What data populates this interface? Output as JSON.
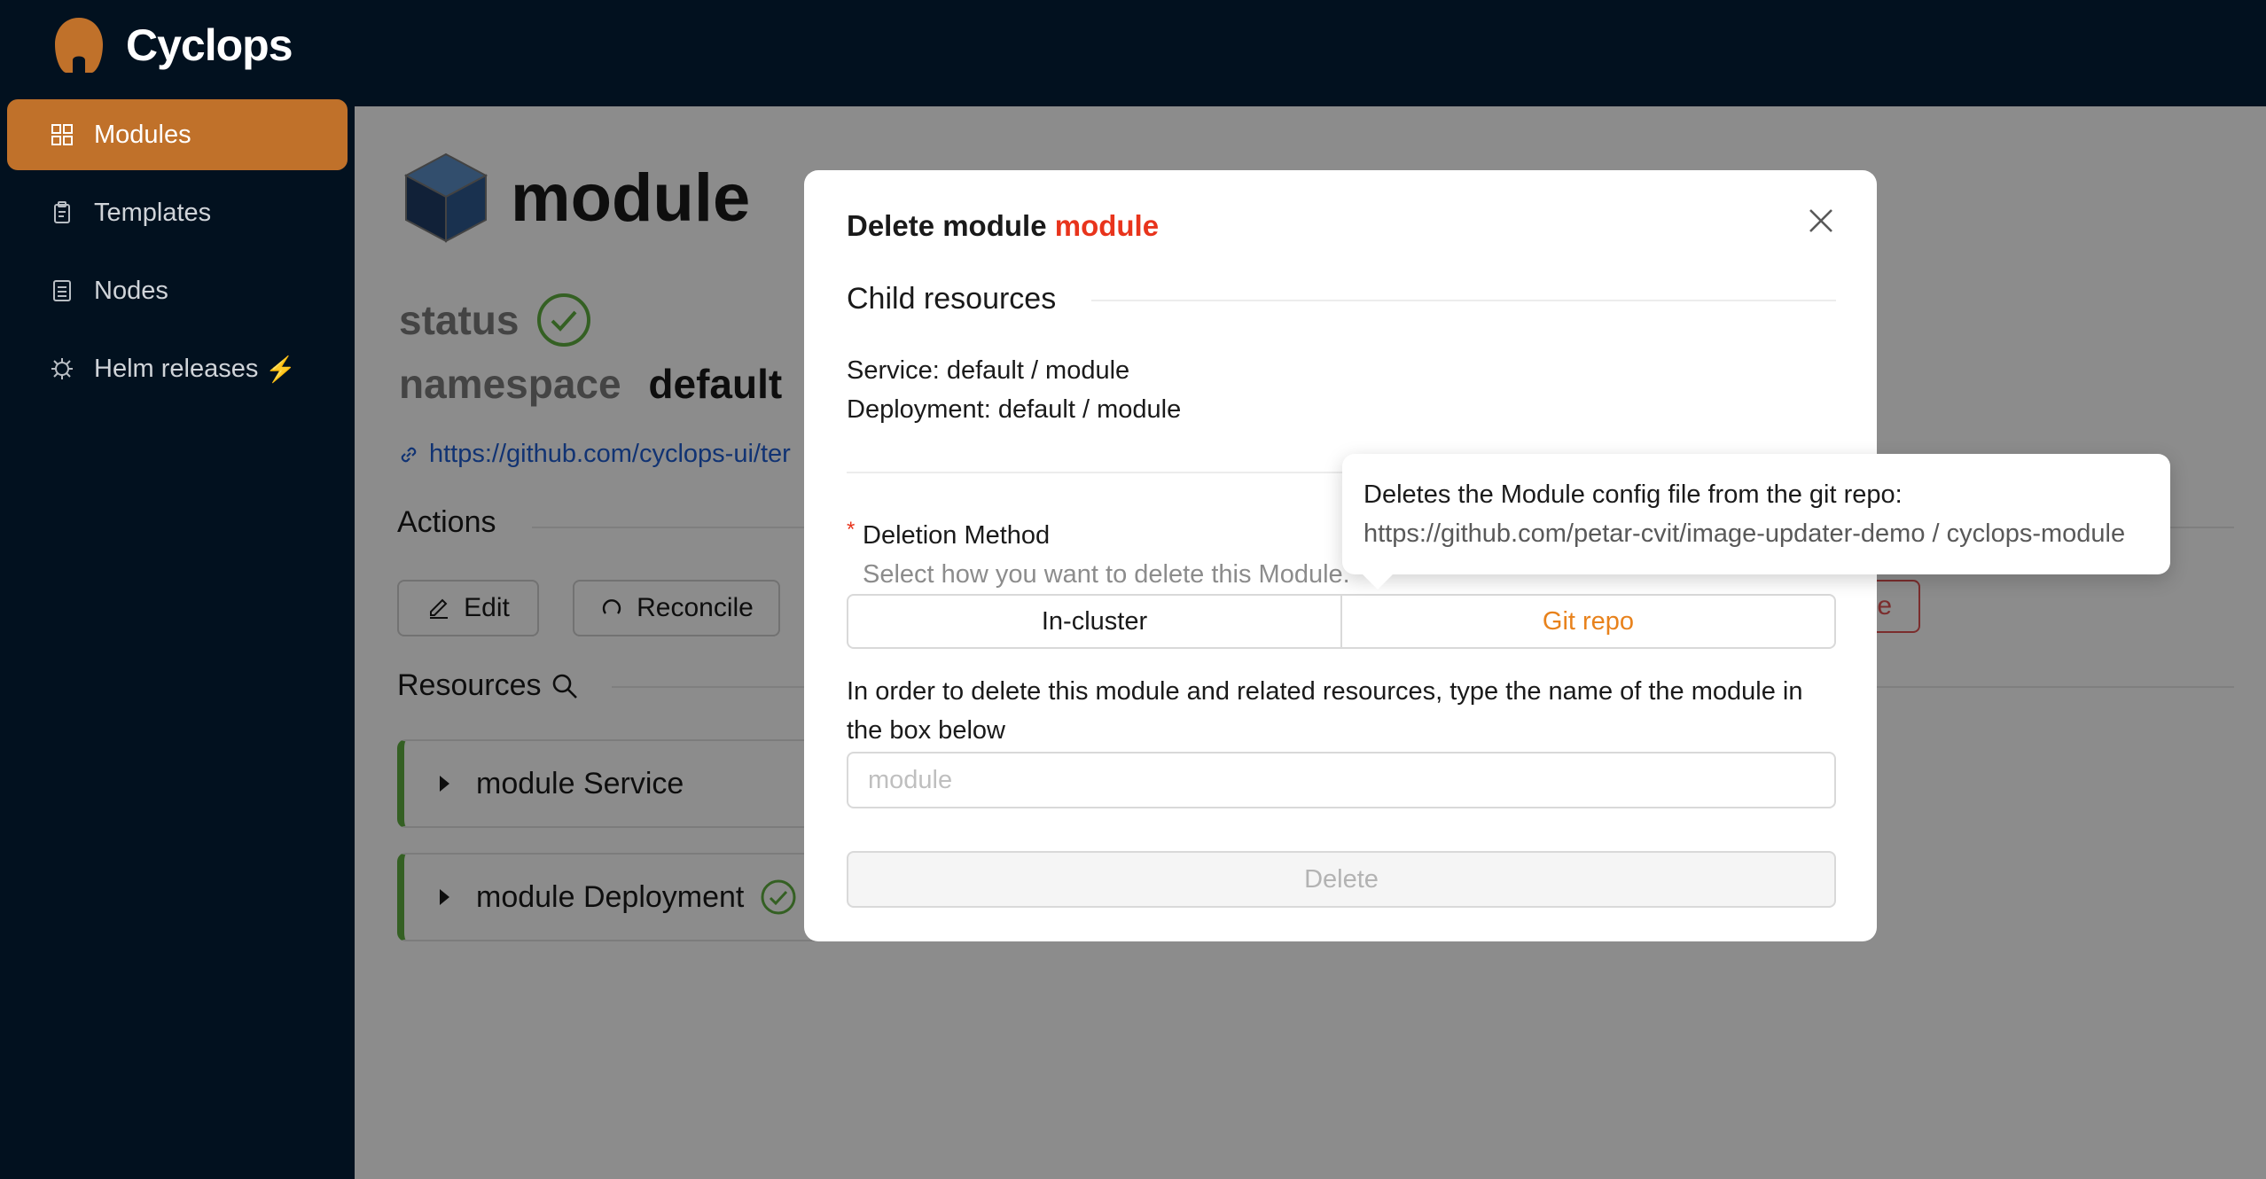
{
  "app": {
    "name": "Cyclops"
  },
  "sidebar": {
    "items": [
      {
        "label": "Modules",
        "icon": "modules-icon",
        "active": true
      },
      {
        "label": "Templates",
        "icon": "templates-icon"
      },
      {
        "label": "Nodes",
        "icon": "nodes-icon"
      },
      {
        "label": "Helm releases",
        "icon": "helm-icon",
        "badge_icon": "lightning-icon"
      }
    ]
  },
  "module": {
    "name": "module",
    "status_label": "status",
    "namespace_label": "namespace",
    "namespace_value": "default",
    "repo_link": "https://github.com/cyclops-ui/ter"
  },
  "actions": {
    "heading": "Actions",
    "edit_label": "Edit",
    "reconcile_label": "Reconcile",
    "delete_partial_label": "e"
  },
  "resources": {
    "heading": "Resources",
    "items": [
      {
        "title": "module Service"
      },
      {
        "title": "module Deployment",
        "status": "ok"
      }
    ]
  },
  "modal": {
    "title_prefix": "Delete module",
    "title_module": "module",
    "child_heading": "Child resources",
    "child_resources": [
      "Service: default / module",
      "Deployment: default / module"
    ],
    "deletion_method_label": "Deletion Method",
    "deletion_method_help": "Select how you want to delete this Module.",
    "options": [
      "In-cluster",
      "Git repo"
    ],
    "selected_option": "Git repo",
    "confirm_text": "In order to delete this module and related resources, type the name of the module in the box below",
    "confirm_placeholder": "module",
    "delete_label": "Delete"
  },
  "tooltip": {
    "line1": "Deletes the Module config file from the git repo:",
    "line2": "https://github.com/petar-cvit/image-updater-demo / cyclops-module"
  },
  "colors": {
    "brand": "#c0712a",
    "accent_red": "#e8341c",
    "selected_orange": "#e8821c",
    "success": "#60b040",
    "link": "#1f5ed1"
  }
}
